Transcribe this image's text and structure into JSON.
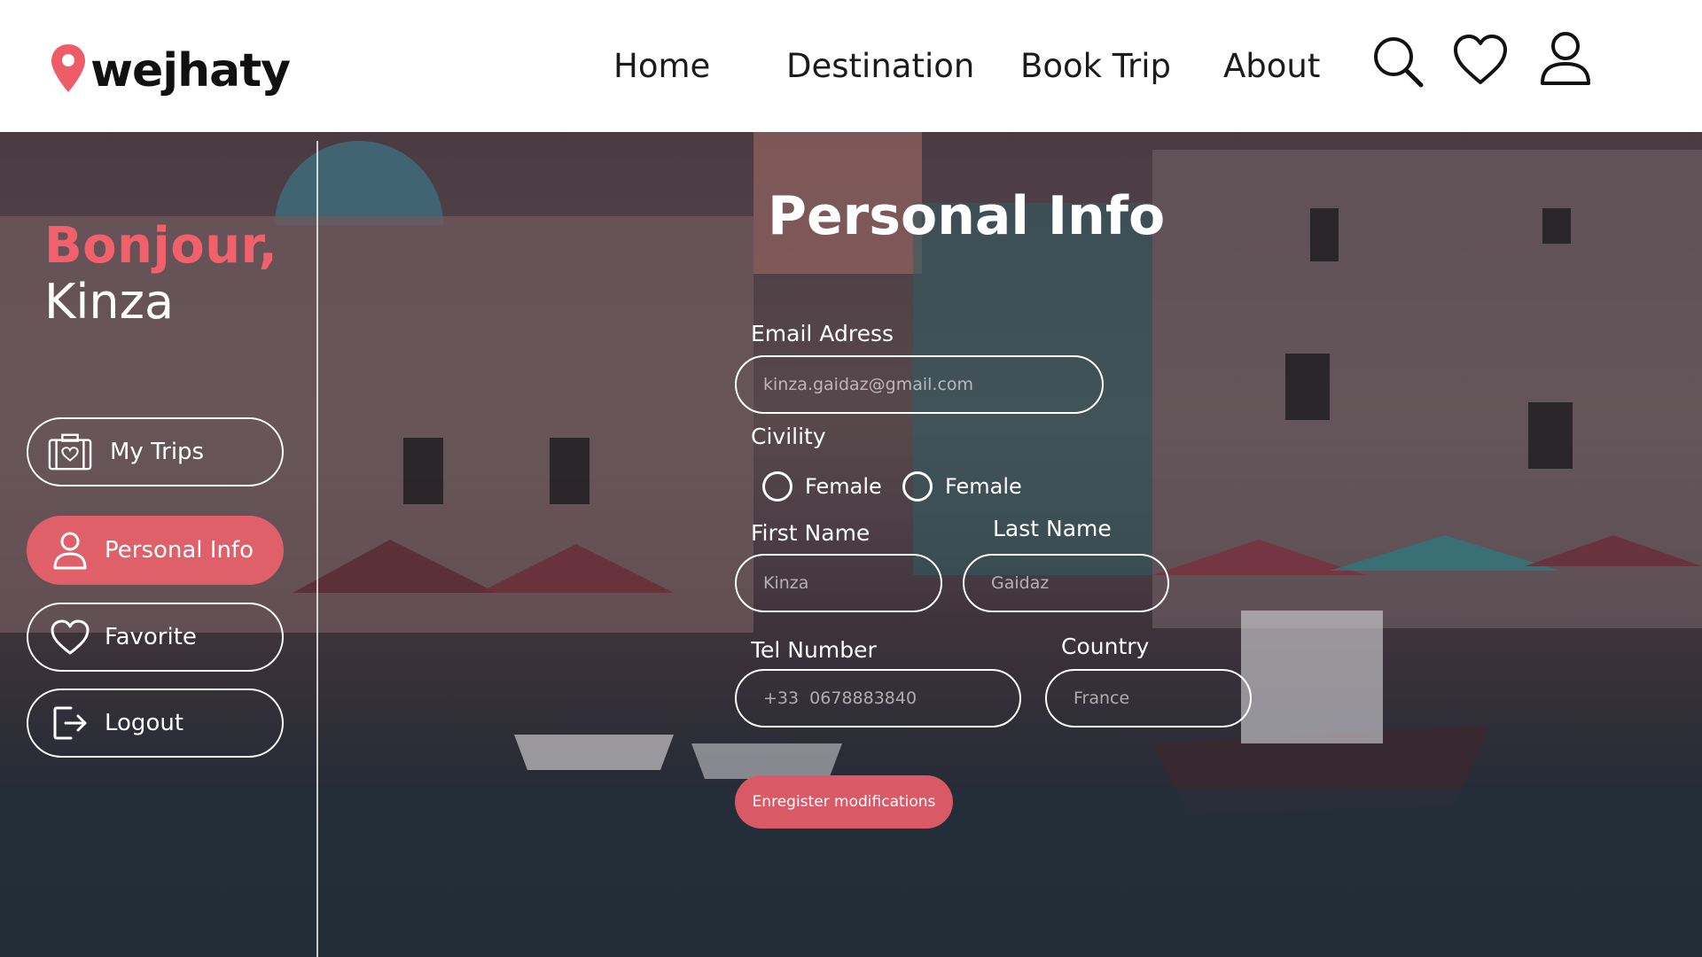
{
  "brand": {
    "name": "wejhaty",
    "accent": "#f2606c"
  },
  "nav": {
    "items": [
      {
        "label": "Home"
      },
      {
        "label": "Destination"
      },
      {
        "label": "Book Trip"
      },
      {
        "label": "About"
      }
    ],
    "icons": [
      "search-icon",
      "heart-icon",
      "user-icon"
    ]
  },
  "sidebar": {
    "greeting": "Bonjour,",
    "user_name": "Kinza",
    "items": [
      {
        "label": "My Trips",
        "icon": "luggage-icon",
        "active": false
      },
      {
        "label": "Personal Info",
        "icon": "user-icon",
        "active": true
      },
      {
        "label": "Favorite",
        "icon": "heart-icon",
        "active": false
      },
      {
        "label": "Logout",
        "icon": "logout-icon",
        "active": false
      }
    ]
  },
  "form": {
    "title": "Personal Info",
    "email": {
      "label": "Email Adress",
      "placeholder": "kinza.gaidaz@gmail.com"
    },
    "civility": {
      "label": "Civility",
      "options": [
        {
          "label": "Female"
        },
        {
          "label": "Female"
        }
      ]
    },
    "first_name": {
      "label": "First Name",
      "placeholder": "Kinza"
    },
    "last_name": {
      "label": "Last Name",
      "placeholder": "Gaidaz"
    },
    "tel": {
      "label": "Tel Number",
      "placeholder": "+33  0678883840"
    },
    "country": {
      "label": "Country",
      "placeholder": "France"
    },
    "save_label": "Enregister modifications"
  }
}
